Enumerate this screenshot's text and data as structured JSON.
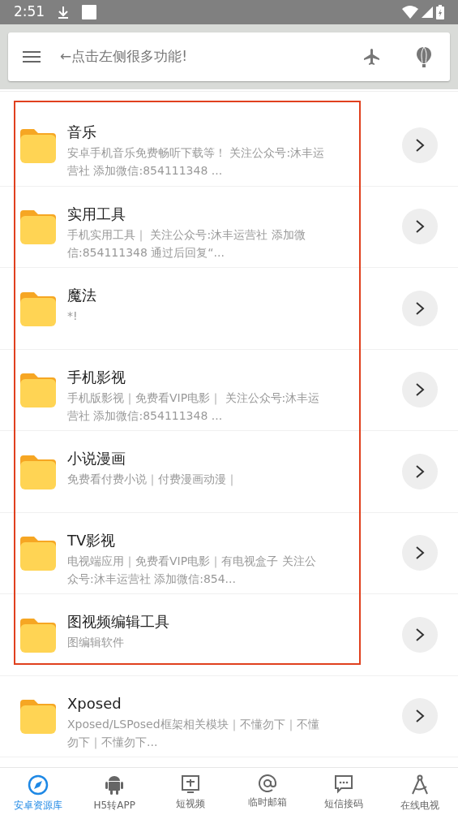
{
  "status_bar": {
    "time": "2:51"
  },
  "search_bar": {
    "placeholder": "←点击左侧很多功能!"
  },
  "framed_items": [
    {
      "title": "音乐",
      "subtitle": "安卓手机音乐免费畅听下载等！ 关注公众号:沐丰运营社 添加微信:854111348 ..."
    },
    {
      "title": "实用工具",
      "subtitle": "手机实用工具｜ 关注公众号:沐丰运营社 添加微信:854111348 通过后回复“..."
    },
    {
      "title": "魔法",
      "subtitle": "*!"
    },
    {
      "title": "手机影视",
      "subtitle": "手机版影视｜免费看VIP电影｜ 关注公众号:沐丰运营社 添加微信:854111348 ..."
    },
    {
      "title": "小说漫画",
      "subtitle": "免费看付费小说｜付费漫画动漫｜"
    },
    {
      "title": "TV影视",
      "subtitle": "电视端应用｜免费看VIP电影｜有电视盒子 关注公众号:沐丰运营社 添加微信:854..."
    },
    {
      "title": "图视频编辑工具",
      "subtitle": "图编辑软件"
    }
  ],
  "items": [
    {
      "title": "Xposed",
      "subtitle": "Xposed/LSPosed框架相关模块｜不懂勿下｜不懂勿下｜不懂勿下..."
    }
  ],
  "bottom_nav": [
    {
      "label": "安卓资源库",
      "kind": "compass",
      "selected": true
    },
    {
      "label": "H5转APP",
      "kind": "android",
      "selected": false
    },
    {
      "label": "短视频",
      "kind": "video",
      "selected": false
    },
    {
      "label": "临时邮箱",
      "kind": "at",
      "selected": false
    },
    {
      "label": "短信接码",
      "kind": "message",
      "selected": false
    },
    {
      "label": "在线电视",
      "kind": "compass-tool",
      "selected": false
    }
  ]
}
